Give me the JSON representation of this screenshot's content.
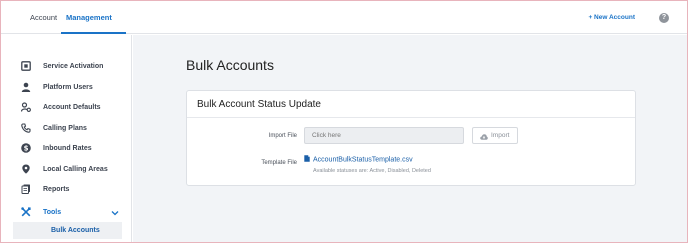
{
  "header": {
    "tabs": [
      {
        "label": "Account"
      },
      {
        "label": "Management"
      }
    ],
    "new_account_label": "+ New Account",
    "help_label": "?"
  },
  "sidebar": {
    "items": [
      {
        "label": "Service Activation",
        "icon": "service-activation-icon"
      },
      {
        "label": "Platform Users",
        "icon": "user-icon"
      },
      {
        "label": "Account Defaults",
        "icon": "account-defaults-icon"
      },
      {
        "label": "Calling Plans",
        "icon": "phone-icon"
      },
      {
        "label": "Inbound Rates",
        "icon": "dollar-icon"
      },
      {
        "label": "Local Calling Areas",
        "icon": "map-pin-icon"
      },
      {
        "label": "Reports",
        "icon": "reports-icon"
      },
      {
        "label": "Tools",
        "icon": "tools-icon",
        "expanded": true
      }
    ],
    "subitems": [
      {
        "label": "Bulk Accounts"
      }
    ]
  },
  "main": {
    "page_title": "Bulk Accounts",
    "card": {
      "title": "Bulk Account Status Update",
      "import_label": "Import File",
      "import_placeholder": "Click here",
      "import_button": "Import",
      "template_label": "Template File",
      "template_link": "AccountBulkStatusTemplate.csv",
      "statuses_hint": "Available statuses are: Active, Disabled, Deleted"
    }
  },
  "colors": {
    "accent": "#1a73c7",
    "link": "#1a5fa8",
    "main_background": "#f2f4f7",
    "frame_border": "#e8b4bc"
  }
}
